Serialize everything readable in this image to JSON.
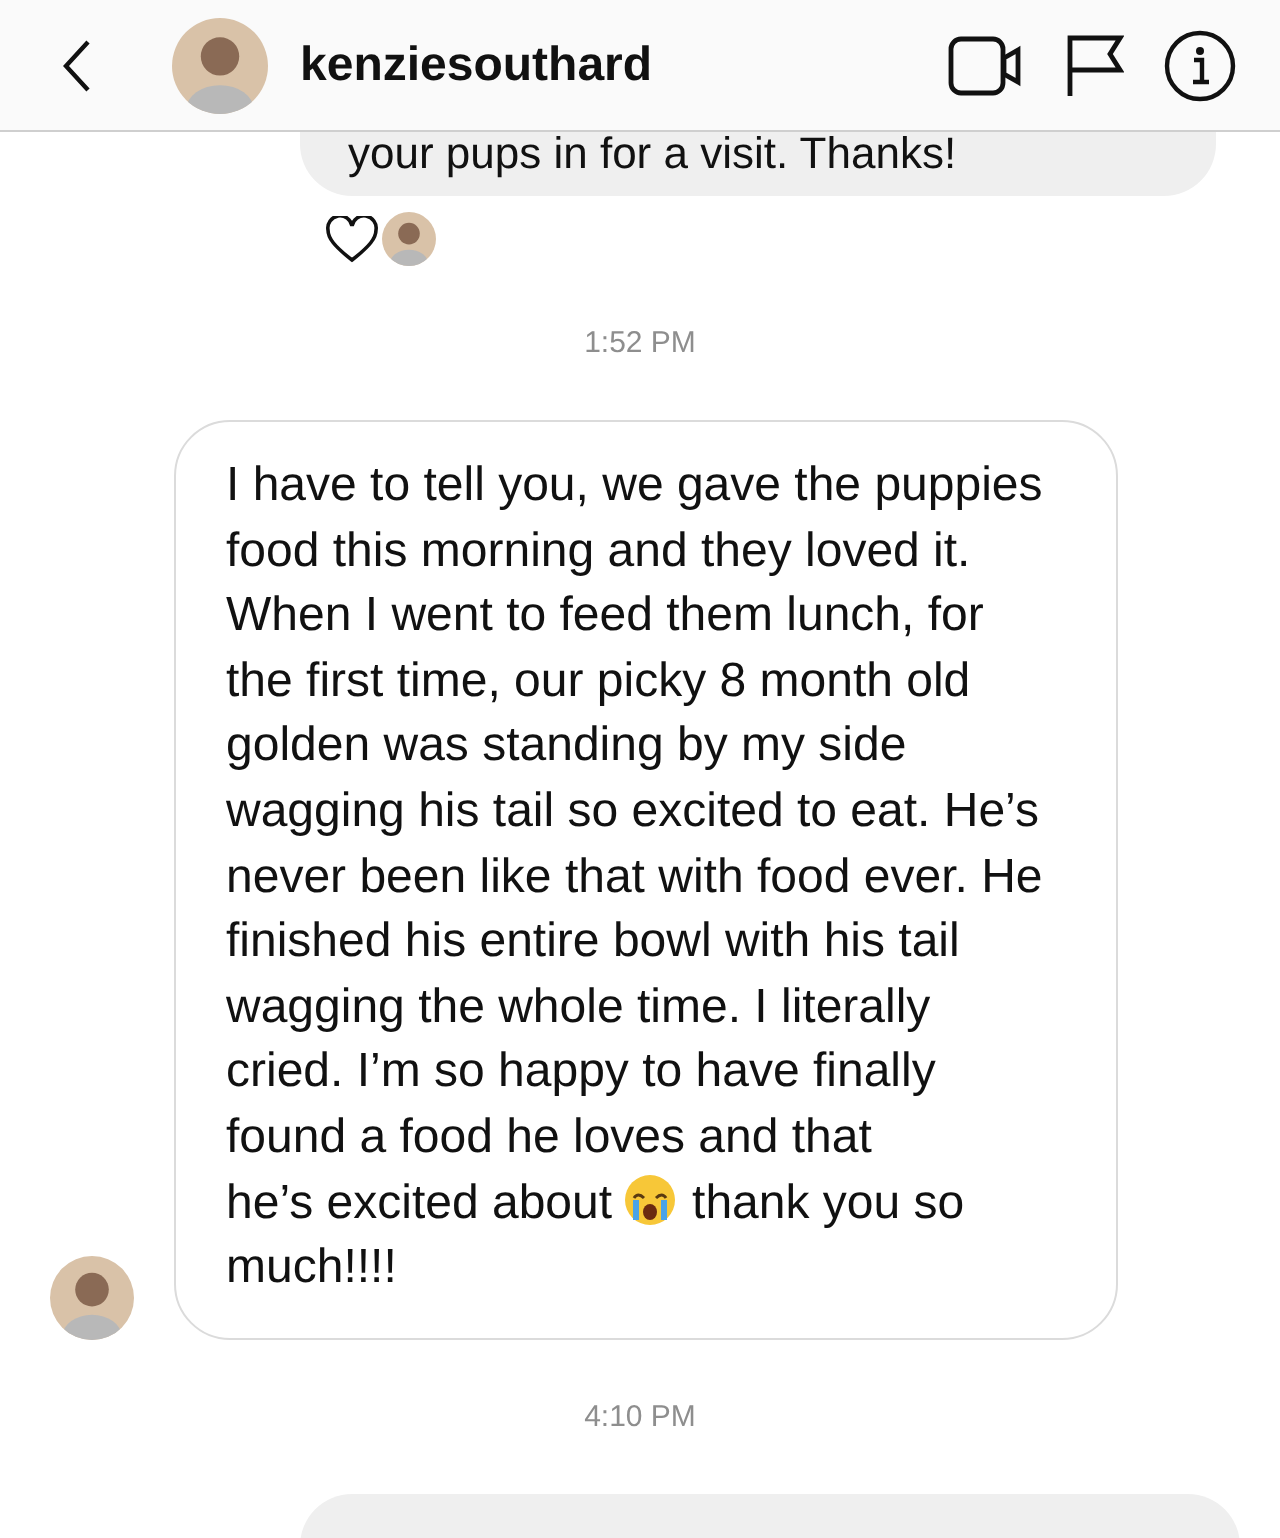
{
  "header": {
    "username": "kenziesouthard"
  },
  "messages": [
    {
      "kind": "outgoing",
      "parts": [
        {
          "kind": "text",
          "text": "your pups in for a visit. Thanks!"
        }
      ],
      "liked": true
    },
    {
      "kind": "time",
      "text": "1:52 PM"
    },
    {
      "kind": "incoming",
      "parts": [
        {
          "kind": "text",
          "text": "I have to tell you, we gave the puppies food this morning and they loved it. When I went to feed them lunch, for the first time, our picky 8 month old golden was standing by my side wagging his tail so excited to eat. He’s never been like that with food ever. He finished his entire bowl with his tail wagging the whole time. I literally cried. I’m so happy to have finally found a food he loves and that"
        },
        {
          "kind": "text",
          "text": "he’s excited about"
        },
        {
          "kind": "emoji"
        },
        {
          "kind": "text",
          "text": "thank you so"
        },
        {
          "kind": "text",
          "text": "much!!!!"
        }
      ]
    },
    {
      "kind": "time",
      "text": "4:10 PM"
    },
    {
      "kind": "outgoing"
    }
  ]
}
